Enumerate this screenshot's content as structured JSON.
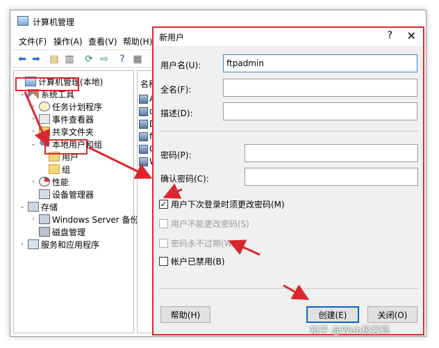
{
  "mmc": {
    "title": "计算机管理",
    "menu": [
      "文件(F)",
      "操作(A)",
      "查看(V)",
      "帮助(H)"
    ],
    "tree": {
      "root": "计算机管理(本地)",
      "system_tools": "系统工具",
      "task_scheduler": "任务计划程序",
      "event_viewer": "事件查看器",
      "shared_folders": "共享文件夹",
      "local_users_groups": "本地用户和组",
      "users": "用户",
      "groups": "组",
      "performance": "性能",
      "device_manager": "设备管理器",
      "storage": "存储",
      "windows_server_backup": "Windows Server 备份",
      "disk_management": "磁盘管理",
      "services_apps": "服务和应用程序"
    },
    "list": {
      "header": "名称",
      "items": [
        "A",
        "d",
        "D",
        "f",
        "G",
        "W"
      ]
    }
  },
  "dialog": {
    "title": "新用户",
    "help_glyph": "?",
    "close_glyph": "✕",
    "username_label": "用户名(U):",
    "username_value": "ftpadmin",
    "fullname_label": "全名(F):",
    "fullname_value": "",
    "description_label": "描述(D):",
    "description_value": "",
    "password_label": "密码(P):",
    "password_value": "",
    "confirm_label": "确认密码(C):",
    "confirm_value": "",
    "checkboxes": [
      {
        "label": "用户下次登录时须更改密码(M)",
        "checked": true,
        "enabled": true
      },
      {
        "label": "用户不能更改密码(S)",
        "checked": false,
        "enabled": false
      },
      {
        "label": "密码永不过期(W)",
        "checked": false,
        "enabled": false
      },
      {
        "label": "帐户已禁用(B)",
        "checked": false,
        "enabled": true
      }
    ],
    "help_button": "帮助(H)",
    "create_button": "创建(E)",
    "close_button": "关闭(O)"
  },
  "watermark": "知乎 @Web极客码",
  "colors": {
    "annotation": "#d9272e",
    "focus": "#3b7fd0",
    "dialog_bg": "#f0f0f0"
  }
}
